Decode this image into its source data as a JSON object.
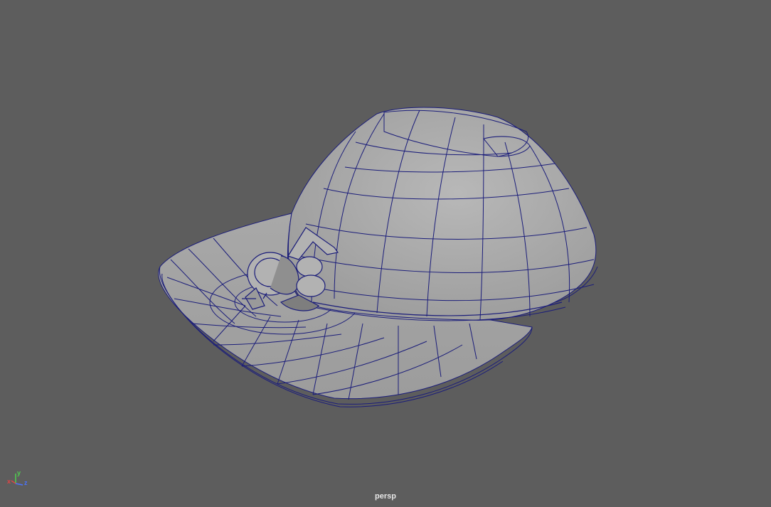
{
  "viewport": {
    "camera_name": "persp",
    "background_color": "#5d5d5d",
    "wire_color": "#1b1d7a",
    "surface_color": "#a4a4a4"
  },
  "axis_gizmo": {
    "x_label": "x",
    "y_label": "y",
    "z_label": "z",
    "x_color": "#e04545",
    "y_color": "#4fd24f",
    "z_color": "#4a73ff"
  }
}
